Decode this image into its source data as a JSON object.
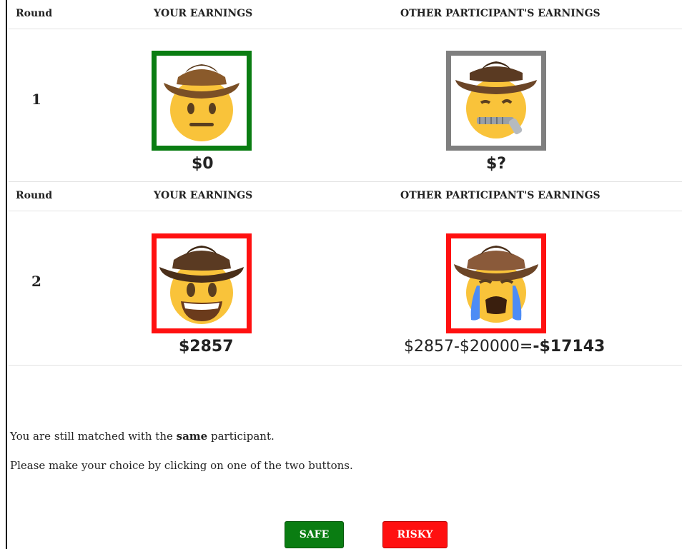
{
  "table": {
    "rounds": [
      {
        "header": {
          "round": "Round",
          "yours": "YOUR EARNINGS",
          "other": "OTHER PARTICIPANT'S EARNINGS"
        },
        "number": "1",
        "your_emoji": "neutral-cowboy-icon",
        "your_frame_color": "#0a7d12",
        "your_amount": "$0",
        "other_emoji": "zipper-mouth-cowboy-icon",
        "other_frame_color": "#7f7f7f",
        "other_amount": "$?"
      },
      {
        "header": {
          "round": "Round",
          "yours": "YOUR EARNINGS",
          "other": "OTHER PARTICIPANT'S EARNINGS"
        },
        "number": "2",
        "your_emoji": "grinning-cowboy-icon",
        "your_frame_color": "#ff1010",
        "your_amount": "$2857",
        "other_emoji": "crying-cowboy-icon",
        "other_frame_color": "#ff1010",
        "other_amount_formula": "$2857-$20000=",
        "other_amount_result": "-$17143"
      }
    ]
  },
  "message": {
    "line1_prefix": "You are still matched with the ",
    "line1_bold": "same",
    "line1_suffix": " participant.",
    "line2": "Please make your choice by clicking on one of the two buttons."
  },
  "buttons": {
    "safe_label": "SAFE",
    "safe_color": "#0a7d12",
    "risky_label": "RISKY",
    "risky_color": "#ff1010"
  }
}
